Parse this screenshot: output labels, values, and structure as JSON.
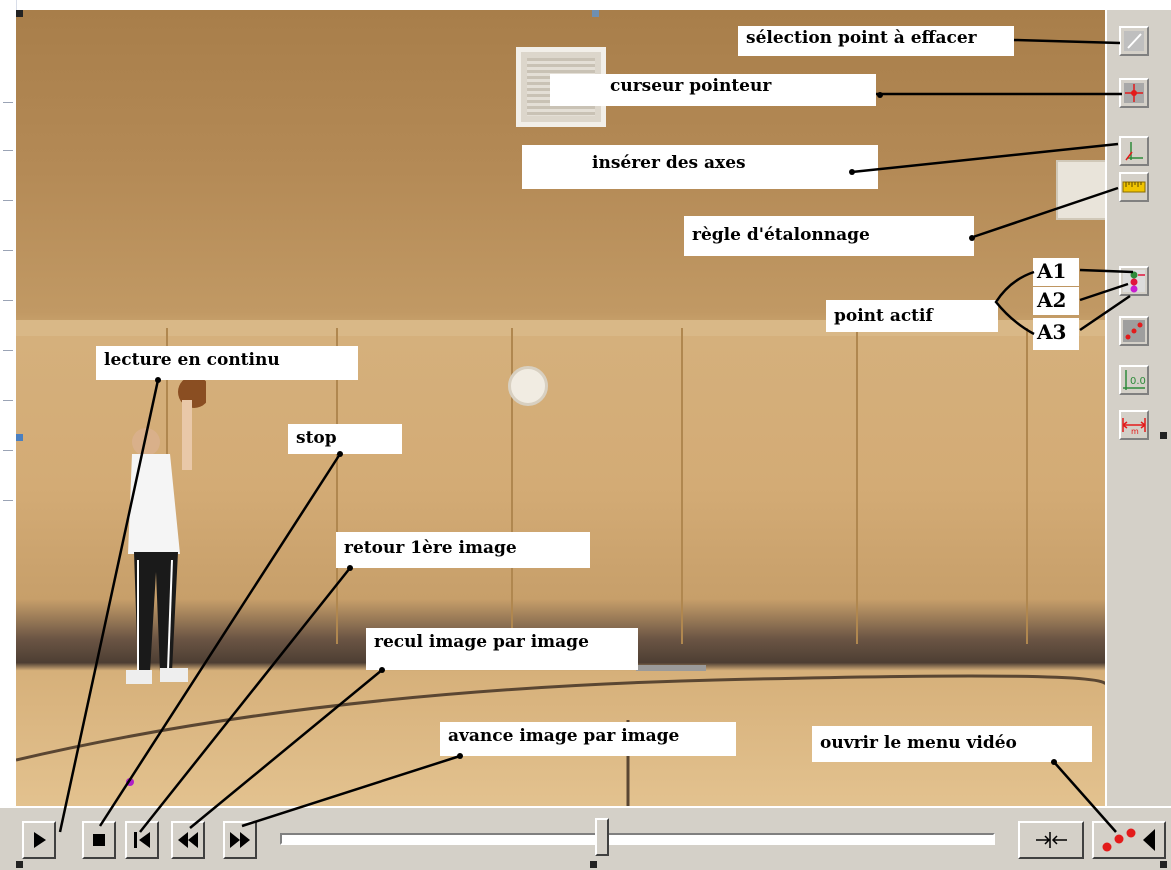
{
  "annotations": {
    "selection_point_effacer": "sélection point à effacer",
    "curseur_pointeur": "curseur pointeur",
    "inserer_axes": "insérer des axes",
    "regle_etalonnage": "règle d'étalonnage",
    "point_actif": "point actif",
    "a1": "A1",
    "a2": "A2",
    "a3": "A3",
    "lecture_continu": "lecture en continu",
    "stop": "stop",
    "retour_premiere_image": "retour 1ère image",
    "recul_image": "recul image par image",
    "avance_image": "avance image par image",
    "ouvrir_menu_video": "ouvrir le menu vidéo"
  },
  "right_toolbar": {
    "items": [
      {
        "icon": "eraser-selection-icon"
      },
      {
        "icon": "crosshair-pointer-icon"
      },
      {
        "icon": "axes-icon"
      },
      {
        "icon": "ruler-icon"
      },
      {
        "icon": "active-point-icon"
      },
      {
        "icon": "points-icon"
      },
      {
        "icon": "origin-coordinates-icon"
      },
      {
        "icon": "distance-measure-icon"
      }
    ],
    "calibration_readout": "0.0",
    "scale_unit": "m"
  },
  "bottom_toolbar": {
    "buttons": [
      {
        "icon": "play-icon"
      },
      {
        "icon": "stop-icon"
      },
      {
        "icon": "first-frame-icon"
      },
      {
        "icon": "step-back-icon"
      },
      {
        "icon": "step-forward-icon"
      },
      {
        "icon": "fit-frame-icon"
      },
      {
        "icon": "video-menu-icon"
      }
    ],
    "slider_position": 0.45
  },
  "colors": {
    "toolbar": "#d4d0c8",
    "point_a1": "#2e8b3a",
    "point_a2": "#e0143c",
    "point_a3": "#c81ecf",
    "accent_red": "#e31b1b"
  }
}
